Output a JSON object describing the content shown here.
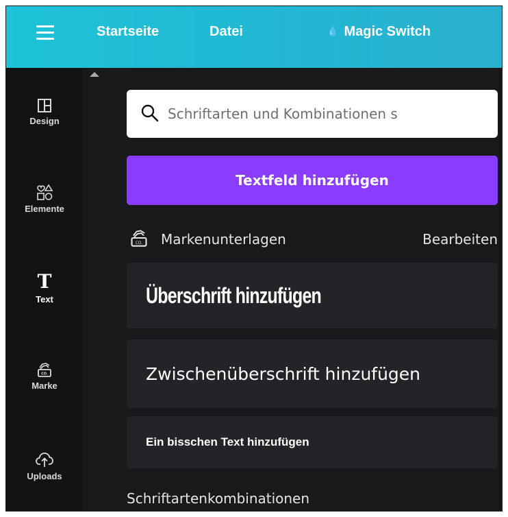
{
  "topbar": {
    "start_label": "Startseite",
    "file_label": "Datei",
    "magic_label": "Magic Switch",
    "color": "#20b8d3"
  },
  "rail": {
    "items": [
      {
        "label": "Design",
        "icon": "layout-icon"
      },
      {
        "label": "Elemente",
        "icon": "shapes-icon"
      },
      {
        "label": "Text",
        "icon": "text-icon",
        "active": true
      },
      {
        "label": "Marke",
        "icon": "brand-kit-icon"
      },
      {
        "label": "Uploads",
        "icon": "cloud-upload-icon"
      }
    ]
  },
  "panel": {
    "search": {
      "placeholder": "Schriftarten und Kombinationen s"
    },
    "add_textbox_label": "Textfeld hinzufügen",
    "accent": "#8b3dff",
    "brand": {
      "label": "Markenunterlagen",
      "edit_label": "Bearbeiten"
    },
    "text_options": {
      "heading": "Überschrift hinzufügen",
      "subheading": "Zwischenüberschrift hinzufügen",
      "body": "Ein bisschen Text hinzufügen"
    },
    "combos_title": "Schriftartenkombinationen"
  }
}
